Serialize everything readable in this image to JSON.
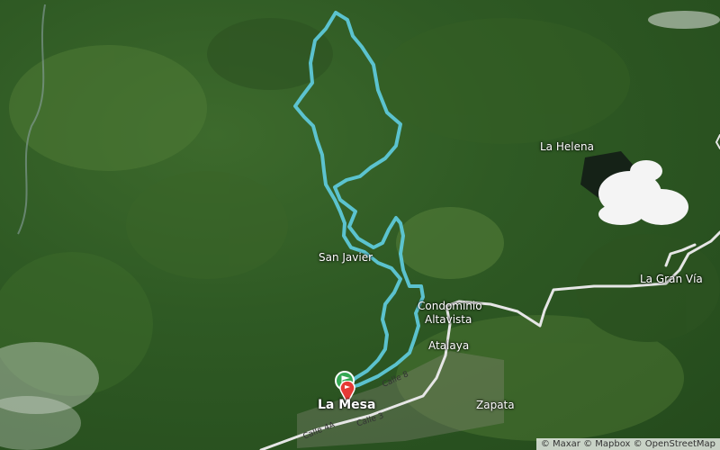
{
  "map": {
    "style": "satellite",
    "route_color": "#5ec8d8",
    "road_color": "#e6e6e6",
    "places": {
      "la_helena": "La Helena",
      "san_javier": "San Javier",
      "condominio_altavista_line1": "Condominio",
      "condominio_altavista_line2": "Altavista",
      "atalaya": "Atalaya",
      "la_gran_via": "La Gran Vía",
      "zapata": "Zapata",
      "la_mesa": "La Mesa"
    },
    "streets": {
      "calle_8": "Calle 8",
      "calle_4a": "Calle 4A",
      "calle_3": "Calle 3"
    },
    "markers": {
      "start": "start-flag-icon",
      "end": "end-pin-icon",
      "start_color": "#34a853",
      "end_color": "#e53935"
    },
    "attribution": "© Maxar © Mapbox © OpenStreetMap"
  }
}
